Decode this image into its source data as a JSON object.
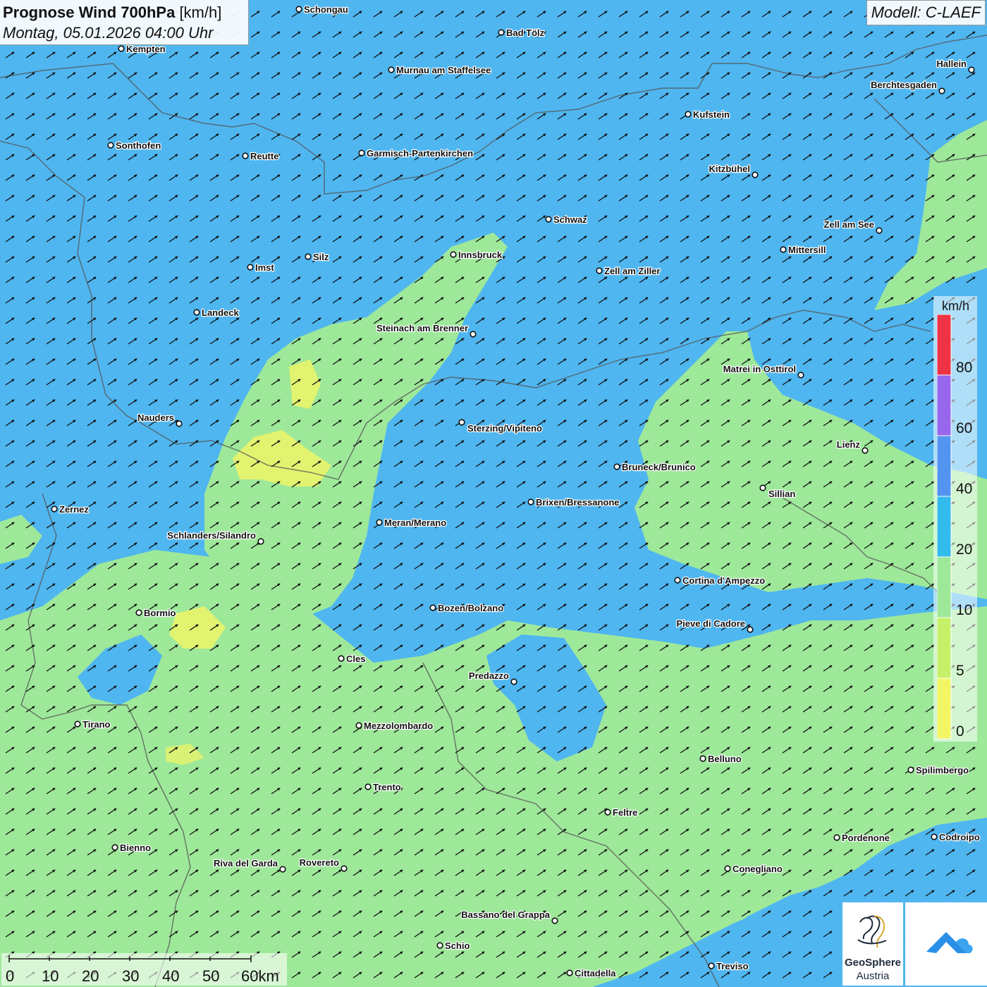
{
  "header": {
    "title_bold": "Prognose Wind 700hPa",
    "title_unit": "[km/h]",
    "datetime": "Montag, 05.01.2026 04:00 Uhr",
    "model": "Modell: C-LAEF"
  },
  "colors": {
    "wind_0_5": "#f2f564",
    "wind_5_10": "#c6f06a",
    "wind_10_20": "#9ee89a",
    "wind_20_40": "#4fb6f0",
    "wind_40_60": "#5294f0",
    "wind_60_80": "#9966ee",
    "wind_80_plus": "#ee3344",
    "arrows": "#111111"
  },
  "legend": {
    "unit": "km/h",
    "ticks": [
      "0",
      "5",
      "10",
      "20",
      "40",
      "60",
      "80"
    ]
  },
  "scale_bar": {
    "labels": [
      "0",
      "10",
      "20",
      "30",
      "40",
      "50",
      "60km"
    ]
  },
  "logo": {
    "line1": "GeoSphere",
    "line2": "Austria"
  },
  "cities": [
    {
      "name": "Schongau"
    },
    {
      "name": "Bad Tölz"
    },
    {
      "name": "Kempten"
    },
    {
      "name": "Murnau am Staffelsee"
    },
    {
      "name": "Hallein"
    },
    {
      "name": "Berchtesgaden"
    },
    {
      "name": "Kufstein"
    },
    {
      "name": "Sonthofen"
    },
    {
      "name": "Reutte"
    },
    {
      "name": "Garmisch-Partenkirchen"
    },
    {
      "name": "Kitzbühel"
    },
    {
      "name": "Schwaz"
    },
    {
      "name": "Zell am See"
    },
    {
      "name": "Mittersill"
    },
    {
      "name": "Innsbruck"
    },
    {
      "name": "Silz"
    },
    {
      "name": "Imst"
    },
    {
      "name": "Zell am Ziller"
    },
    {
      "name": "Landeck"
    },
    {
      "name": "Steinach am Brenner"
    },
    {
      "name": "Matrei in Osttirol"
    },
    {
      "name": "Nauders"
    },
    {
      "name": "Sterzing/Vipiteno"
    },
    {
      "name": "Lienz"
    },
    {
      "name": "Bruneck/Brunico"
    },
    {
      "name": "Sillian"
    },
    {
      "name": "Zernez"
    },
    {
      "name": "Brixen/Bressanone"
    },
    {
      "name": "Meran/Merano"
    },
    {
      "name": "Schlanders/Silandro"
    },
    {
      "name": "Cortina d'Ampezzo"
    },
    {
      "name": "Bozen/Bolzano"
    },
    {
      "name": "Bormio"
    },
    {
      "name": "Pieve di Cadore"
    },
    {
      "name": "Cles"
    },
    {
      "name": "Predazzo"
    },
    {
      "name": "Tirano"
    },
    {
      "name": "Mezzolombardo"
    },
    {
      "name": "Belluno"
    },
    {
      "name": "Spilimbergo"
    },
    {
      "name": "Trento"
    },
    {
      "name": "Feltre"
    },
    {
      "name": "Pordenone"
    },
    {
      "name": "Codroipo"
    },
    {
      "name": "Bienno"
    },
    {
      "name": "Riva del Garda"
    },
    {
      "name": "Rovereto"
    },
    {
      "name": "Conegliano"
    },
    {
      "name": "Bassano del Grappa"
    },
    {
      "name": "Schio"
    },
    {
      "name": "Treviso"
    },
    {
      "name": "Cittadella"
    }
  ]
}
